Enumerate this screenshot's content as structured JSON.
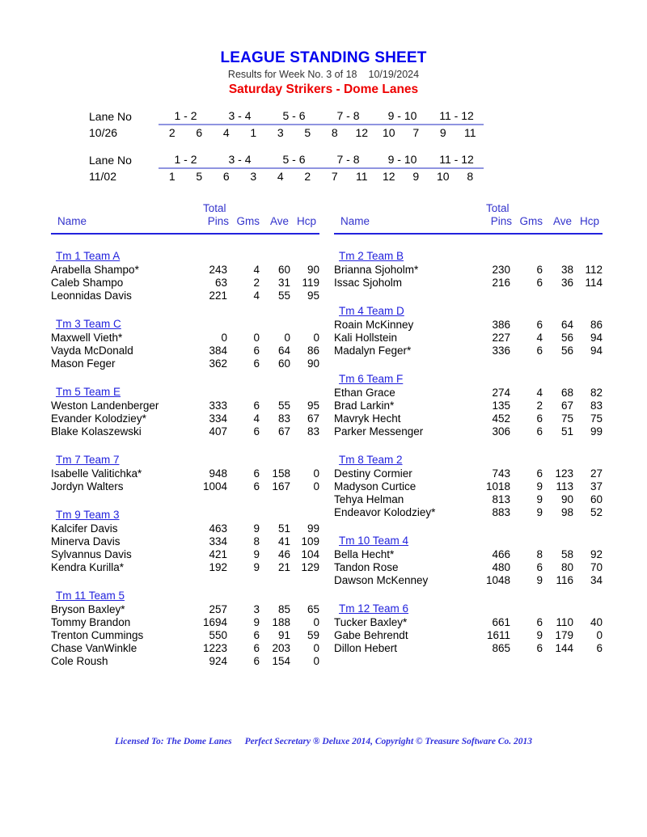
{
  "header": {
    "title": "LEAGUE STANDING SHEET",
    "subtitle": "Results for Week No. 3 of 18",
    "date": "10/19/2024",
    "league": "Saturday Strikers - Dome Lanes",
    "title_color": "#0000ee",
    "league_color": "#ee0000"
  },
  "schedule": {
    "lane_label": "Lane No",
    "lane_pairs": [
      "1 - 2",
      "3 - 4",
      "5 - 6",
      "7 - 8",
      "9 - 10",
      "11 - 12"
    ],
    "weeks": [
      {
        "date": "10/26",
        "teams": [
          "2",
          "6",
          "4",
          "1",
          "3",
          "5",
          "8",
          "12",
          "10",
          "7",
          "9",
          "11"
        ]
      },
      {
        "date": "11/02",
        "teams": [
          "1",
          "5",
          "6",
          "3",
          "4",
          "2",
          "7",
          "11",
          "12",
          "9",
          "10",
          "8"
        ]
      }
    ]
  },
  "columns": {
    "total": "Total",
    "name": "Name",
    "pins": "Pins",
    "gms": "Gms",
    "ave": "Ave",
    "hcp": "Hcp"
  },
  "left_teams": [
    {
      "team": "Tm 1 Team A",
      "players": [
        {
          "name": "Arabella Shampo*",
          "pins": "243",
          "gms": "4",
          "ave": "60",
          "hcp": "90"
        },
        {
          "name": "Caleb Shampo",
          "pins": "63",
          "gms": "2",
          "ave": "31",
          "hcp": "119"
        },
        {
          "name": "Leonnidas Davis",
          "pins": "221",
          "gms": "4",
          "ave": "55",
          "hcp": "95"
        }
      ]
    },
    {
      "team": "Tm 3 Team C",
      "players": [
        {
          "name": "Maxwell Vieth*",
          "pins": "0",
          "gms": "0",
          "ave": "0",
          "hcp": "0"
        },
        {
          "name": "Vayda McDonald",
          "pins": "384",
          "gms": "6",
          "ave": "64",
          "hcp": "86"
        },
        {
          "name": "Mason Feger",
          "pins": "362",
          "gms": "6",
          "ave": "60",
          "hcp": "90"
        }
      ]
    },
    {
      "team": "Tm 5 Team E",
      "players": [
        {
          "name": "Weston Landenberger",
          "pins": "333",
          "gms": "6",
          "ave": "55",
          "hcp": "95"
        },
        {
          "name": "Evander Kolodziey*",
          "pins": "334",
          "gms": "4",
          "ave": "83",
          "hcp": "67"
        },
        {
          "name": "Blake Kolaszewski",
          "pins": "407",
          "gms": "6",
          "ave": "67",
          "hcp": "83"
        }
      ]
    },
    {
      "team": "Tm 7 Team 7",
      "players": [
        {
          "name": "Isabelle Valitichka*",
          "pins": "948",
          "gms": "6",
          "ave": "158",
          "hcp": "0"
        },
        {
          "name": "Jordyn Walters",
          "pins": "1004",
          "gms": "6",
          "ave": "167",
          "hcp": "0"
        }
      ]
    },
    {
      "team": "Tm 9 Team 3",
      "players": [
        {
          "name": "Kalcifer Davis",
          "pins": "463",
          "gms": "9",
          "ave": "51",
          "hcp": "99"
        },
        {
          "name": "Minerva Davis",
          "pins": "334",
          "gms": "8",
          "ave": "41",
          "hcp": "109"
        },
        {
          "name": "Sylvannus Davis",
          "pins": "421",
          "gms": "9",
          "ave": "46",
          "hcp": "104"
        },
        {
          "name": "Kendra Kurilla*",
          "pins": "192",
          "gms": "9",
          "ave": "21",
          "hcp": "129"
        }
      ]
    },
    {
      "team": "Tm 11 Team 5",
      "players": [
        {
          "name": "Bryson Baxley*",
          "pins": "257",
          "gms": "3",
          "ave": "85",
          "hcp": "65"
        },
        {
          "name": "Tommy Brandon",
          "pins": "1694",
          "gms": "9",
          "ave": "188",
          "hcp": "0"
        },
        {
          "name": "Trenton Cummings",
          "pins": "550",
          "gms": "6",
          "ave": "91",
          "hcp": "59"
        },
        {
          "name": "Chase VanWinkle",
          "pins": "1223",
          "gms": "6",
          "ave": "203",
          "hcp": "0"
        },
        {
          "name": "Cole Roush",
          "pins": "924",
          "gms": "6",
          "ave": "154",
          "hcp": "0"
        }
      ]
    }
  ],
  "right_teams": [
    {
      "team": "Tm 2 Team B",
      "players": [
        {
          "name": "Brianna Sjoholm*",
          "pins": "230",
          "gms": "6",
          "ave": "38",
          "hcp": "112"
        },
        {
          "name": "Issac Sjoholm",
          "pins": "216",
          "gms": "6",
          "ave": "36",
          "hcp": "114"
        }
      ]
    },
    {
      "team": "Tm 4 Team D",
      "players": [
        {
          "name": "Roain McKinney",
          "pins": "386",
          "gms": "6",
          "ave": "64",
          "hcp": "86"
        },
        {
          "name": "Kali Hollstein",
          "pins": "227",
          "gms": "4",
          "ave": "56",
          "hcp": "94"
        },
        {
          "name": "Madalyn Feger*",
          "pins": "336",
          "gms": "6",
          "ave": "56",
          "hcp": "94"
        }
      ]
    },
    {
      "team": "Tm 6 Team F",
      "players": [
        {
          "name": "Ethan Grace",
          "pins": "274",
          "gms": "4",
          "ave": "68",
          "hcp": "82"
        },
        {
          "name": "Brad Larkin*",
          "pins": "135",
          "gms": "2",
          "ave": "67",
          "hcp": "83"
        },
        {
          "name": "Mavryk Hecht",
          "pins": "452",
          "gms": "6",
          "ave": "75",
          "hcp": "75"
        },
        {
          "name": "Parker Messenger",
          "pins": "306",
          "gms": "6",
          "ave": "51",
          "hcp": "99"
        }
      ]
    },
    {
      "team": "Tm 8 Team 2",
      "players": [
        {
          "name": "Destiny Cormier",
          "pins": "743",
          "gms": "6",
          "ave": "123",
          "hcp": "27"
        },
        {
          "name": "Madyson Curtice",
          "pins": "1018",
          "gms": "9",
          "ave": "113",
          "hcp": "37"
        },
        {
          "name": "Tehya Helman",
          "pins": "813",
          "gms": "9",
          "ave": "90",
          "hcp": "60"
        },
        {
          "name": "Endeavor Kolodziey*",
          "pins": "883",
          "gms": "9",
          "ave": "98",
          "hcp": "52"
        }
      ]
    },
    {
      "team": "Tm 10 Team 4",
      "players": [
        {
          "name": "Bella Hecht*",
          "pins": "466",
          "gms": "8",
          "ave": "58",
          "hcp": "92"
        },
        {
          "name": "Tandon Rose",
          "pins": "480",
          "gms": "6",
          "ave": "80",
          "hcp": "70"
        },
        {
          "name": "Dawson McKenney",
          "pins": "1048",
          "gms": "9",
          "ave": "116",
          "hcp": "34"
        }
      ]
    },
    {
      "team": "Tm 12 Team 6",
      "players": [
        {
          "name": "Tucker Baxley*",
          "pins": "661",
          "gms": "6",
          "ave": "110",
          "hcp": "40"
        },
        {
          "name": "Gabe Behrendt",
          "pins": "1611",
          "gms": "9",
          "ave": "179",
          "hcp": "0"
        },
        {
          "name": "Dillon Hebert",
          "pins": "865",
          "gms": "6",
          "ave": "144",
          "hcp": "6"
        }
      ]
    }
  ],
  "footer": {
    "licensed_to": "Licensed To: The Dome Lanes",
    "software": "Perfect Secretary ® Deluxe  2014, Copyright © Treasure Software Co. 2013"
  }
}
